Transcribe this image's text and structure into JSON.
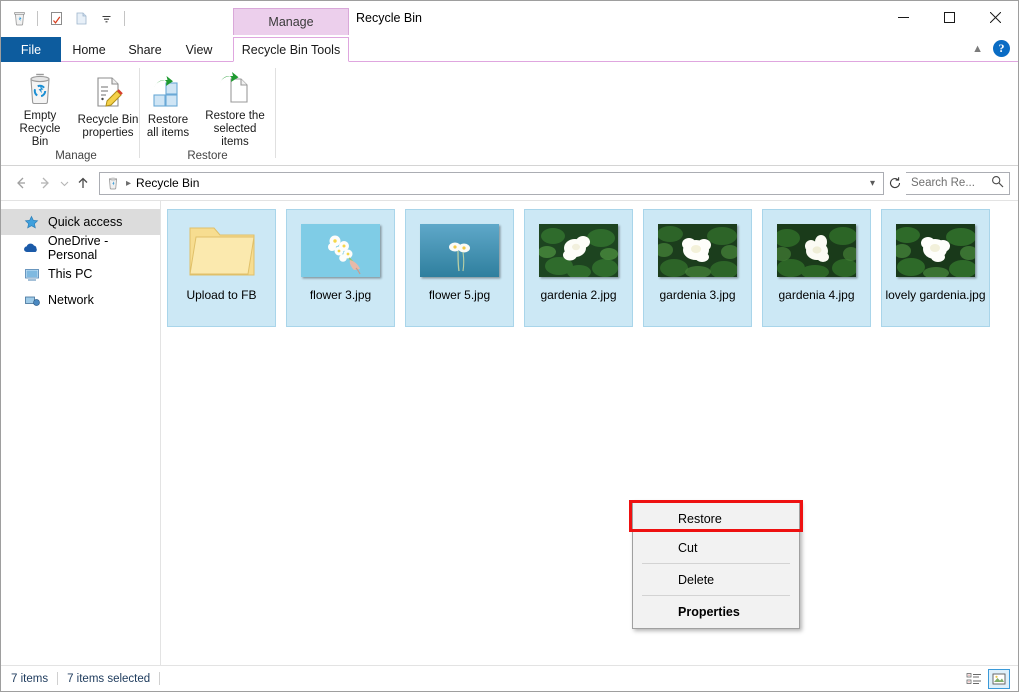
{
  "window": {
    "title": "Recycle Bin",
    "contextual_tab_header": "Manage",
    "controls": {
      "minimize": "minimize-icon",
      "maximize": "maximize-icon",
      "close": "close-icon"
    }
  },
  "quick_access_toolbar": {
    "items": [
      {
        "name": "recycle-bin-icon",
        "label": "Recycle Bin"
      },
      {
        "name": "properties-icon",
        "label": "Properties"
      },
      {
        "name": "paste-icon",
        "label": "Paste"
      },
      {
        "name": "customize-dropdown-icon",
        "label": "Customize Quick Access Toolbar"
      }
    ]
  },
  "tabs": [
    {
      "id": "file",
      "label": "File"
    },
    {
      "id": "home",
      "label": "Home"
    },
    {
      "id": "share",
      "label": "Share"
    },
    {
      "id": "view",
      "label": "View"
    },
    {
      "id": "recycle-bin-tools",
      "label": "Recycle Bin Tools",
      "active": true
    }
  ],
  "tab_right": {
    "collapse": "chevron-up-icon",
    "help": "?"
  },
  "ribbon": {
    "groups": [
      {
        "label": "Manage",
        "buttons": [
          {
            "id": "empty-recycle-bin",
            "line1": "Empty",
            "line2": "Recycle Bin",
            "icon": "recycle-bin-icon"
          },
          {
            "id": "recycle-bin-properties",
            "line1": "Recycle Bin",
            "line2": "properties",
            "icon": "properties-page-icon"
          }
        ]
      },
      {
        "label": "Restore",
        "buttons": [
          {
            "id": "restore-all-items",
            "line1": "Restore",
            "line2": "all items",
            "icon": "restore-all-icon"
          },
          {
            "id": "restore-selected-items",
            "line1": "Restore the",
            "line2": "selected items",
            "icon": "restore-selected-icon"
          }
        ]
      }
    ]
  },
  "address_bar": {
    "back": "back-arrow-icon",
    "forward": "forward-arrow-icon",
    "recent": "chevron-down-icon",
    "up": "up-arrow-icon",
    "path_icon": "recycle-bin-icon",
    "path": "Recycle Bin",
    "dropdown": "chevron-down-icon",
    "refresh": "refresh-icon"
  },
  "search": {
    "placeholder": "Search Re...",
    "icon": "search-icon"
  },
  "sidebar": {
    "items": [
      {
        "id": "quick-access",
        "label": "Quick access",
        "icon": "star-icon",
        "selected": true
      },
      {
        "id": "onedrive",
        "label": "OneDrive - Personal",
        "icon": "cloud-icon",
        "selected": false
      },
      {
        "id": "this-pc",
        "label": "This PC",
        "icon": "monitor-icon",
        "selected": false
      },
      {
        "id": "network",
        "label": "Network",
        "icon": "network-icon",
        "selected": false
      }
    ]
  },
  "files": [
    {
      "id": "upload-to-fb",
      "label": "Upload to FB",
      "type": "folder",
      "selected": true
    },
    {
      "id": "flower-3",
      "label": "flower 3.jpg",
      "type": "image-daisies-blue",
      "selected": true
    },
    {
      "id": "flower-5",
      "label": "flower 5.jpg",
      "type": "image-daisy-teal",
      "selected": true
    },
    {
      "id": "gardenia-2",
      "label": "gardenia 2.jpg",
      "type": "image-gardenia",
      "selected": true
    },
    {
      "id": "gardenia-3",
      "label": "gardenia 3.jpg",
      "type": "image-gardenia",
      "selected": true
    },
    {
      "id": "gardenia-4",
      "label": "gardenia 4.jpg",
      "type": "image-gardenia",
      "selected": true
    },
    {
      "id": "lovely-gardenia",
      "label": "lovely gardenia.jpg",
      "type": "image-gardenia",
      "selected": true
    }
  ],
  "context_menu": {
    "items": [
      {
        "id": "restore",
        "label": "Restore",
        "bold": false,
        "highlighted": true,
        "separator_after": true
      },
      {
        "id": "cut",
        "label": "Cut",
        "bold": false,
        "highlighted": false,
        "separator_after": true
      },
      {
        "id": "delete",
        "label": "Delete",
        "bold": false,
        "highlighted": false,
        "separator_after": true
      },
      {
        "id": "properties",
        "label": "Properties",
        "bold": true,
        "highlighted": false,
        "separator_after": false
      }
    ]
  },
  "status_bar": {
    "item_count": "7 items",
    "selection": "7 items selected",
    "views": [
      {
        "id": "details-view",
        "icon": "details-view-icon",
        "active": false
      },
      {
        "id": "large-icons-view",
        "icon": "large-icons-view-icon",
        "active": true
      }
    ]
  },
  "colors": {
    "file_tab": "#0d5c9e",
    "contextual_tab": "#eccfec",
    "contextual_border": "#dfa6df",
    "selection_fill": "#cce8f5",
    "selection_border": "#a9d5ea",
    "highlight_box": "#ee1111",
    "status_text": "#1d3a5c"
  }
}
